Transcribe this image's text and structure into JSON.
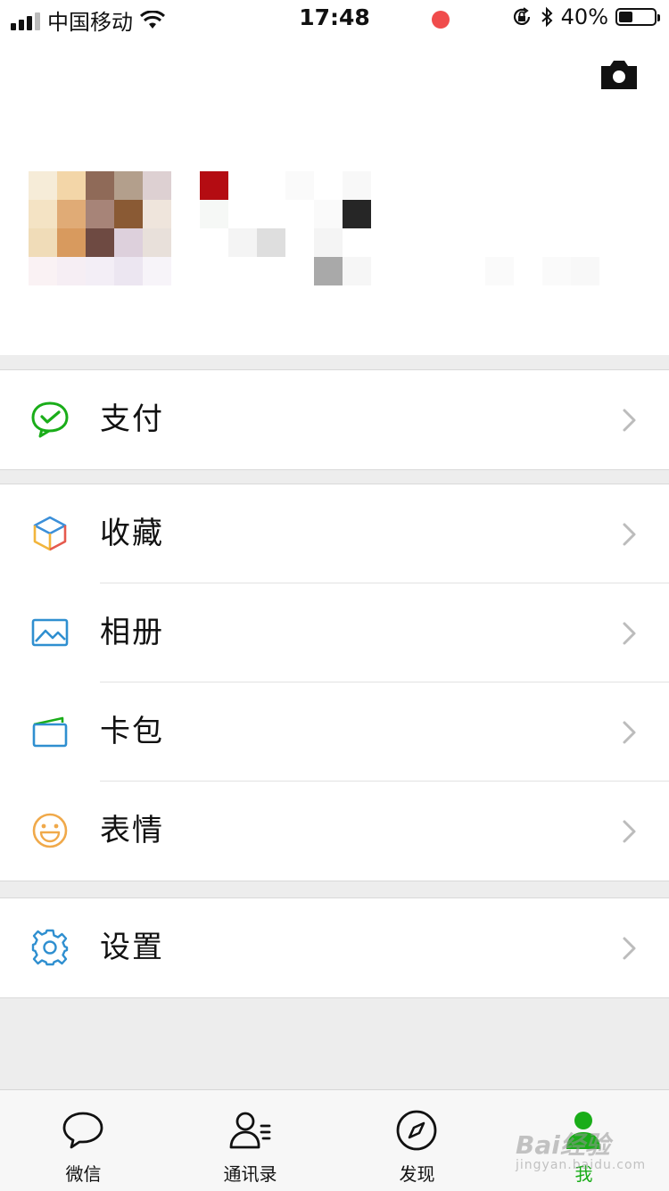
{
  "status": {
    "carrier": "中国移动",
    "time": "17:48",
    "battery": "40%",
    "battery_level": 0.4
  },
  "groups": [
    {
      "items": [
        {
          "label": "支付",
          "icon": "wechat-pay-icon"
        }
      ]
    },
    {
      "items": [
        {
          "label": "收藏",
          "icon": "favorites-cube-icon"
        },
        {
          "label": "相册",
          "icon": "album-picture-icon"
        },
        {
          "label": "卡包",
          "icon": "card-wallet-icon"
        },
        {
          "label": "表情",
          "icon": "smiley-icon"
        }
      ]
    },
    {
      "items": [
        {
          "label": "设置",
          "icon": "gear-icon"
        }
      ]
    }
  ],
  "tabs": [
    {
      "label": "微信",
      "icon": "chat-bubble-icon"
    },
    {
      "label": "通讯录",
      "icon": "contacts-icon"
    },
    {
      "label": "发现",
      "icon": "compass-icon"
    },
    {
      "label": "我",
      "icon": "me-person-icon"
    }
  ],
  "colors": {
    "accent_green": "#1aad19",
    "badge_red": "#f04c4c"
  },
  "watermark": {
    "brand": "Bai",
    "brand_suffix": "经验",
    "url": "jingyan.baidu.com"
  }
}
